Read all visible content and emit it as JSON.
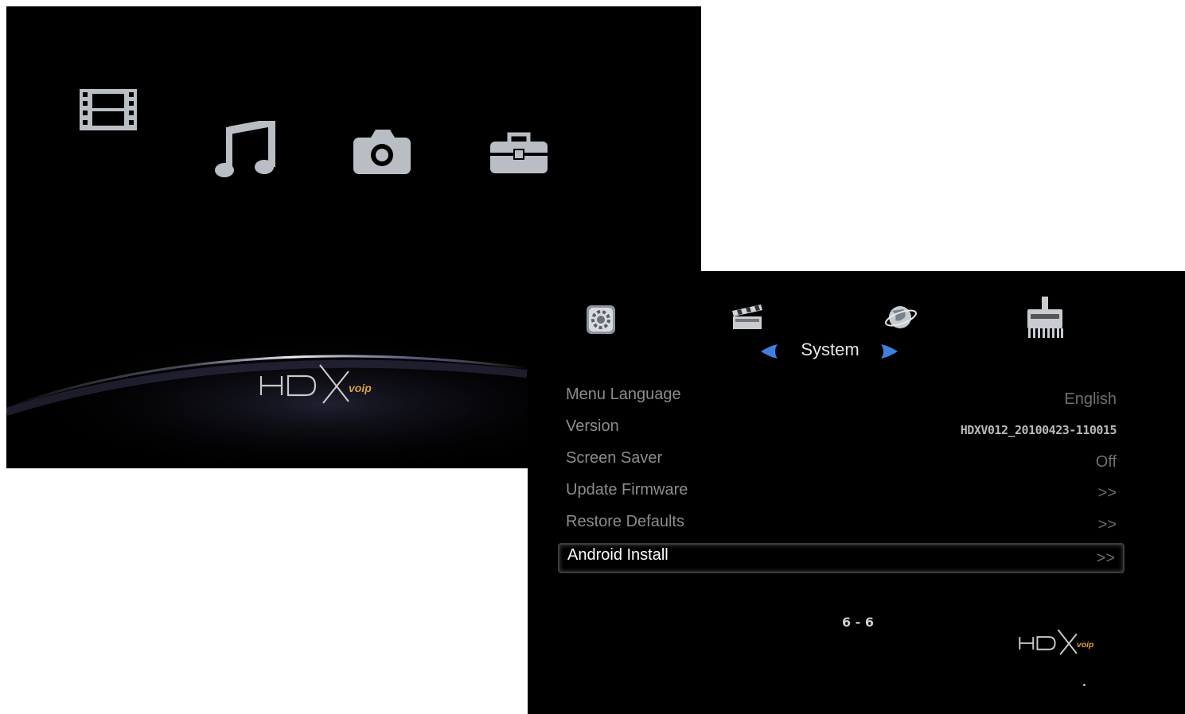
{
  "home": {
    "icons": [
      "film-icon",
      "music-note-icon",
      "camera-icon",
      "toolbox-icon"
    ],
    "logo_text": "HDX voip"
  },
  "settings": {
    "category_icons": [
      "system-gear-icon",
      "clapperboard-icon",
      "network-globe-icon",
      "ethernet-icon"
    ],
    "category_title": "System",
    "menu": [
      {
        "label": "Menu Language",
        "value": "English"
      },
      {
        "label": "Version",
        "value": "HDXV012_20100423-110015"
      },
      {
        "label": "Screen Saver",
        "value": "Off"
      },
      {
        "label": "Update Firmware",
        "value": ">>"
      },
      {
        "label": "Restore Defaults",
        "value": ">>"
      },
      {
        "label": "Android Install",
        "value": ">>"
      }
    ],
    "selected_index": 5,
    "page_indicator": "6 - 6",
    "logo_text": "HDX voip"
  },
  "colors": {
    "background": "#000000",
    "icon_grey": "#b9bec4",
    "arrow_blue": "#3f7fe0",
    "logo_accent": "#d9a040"
  }
}
